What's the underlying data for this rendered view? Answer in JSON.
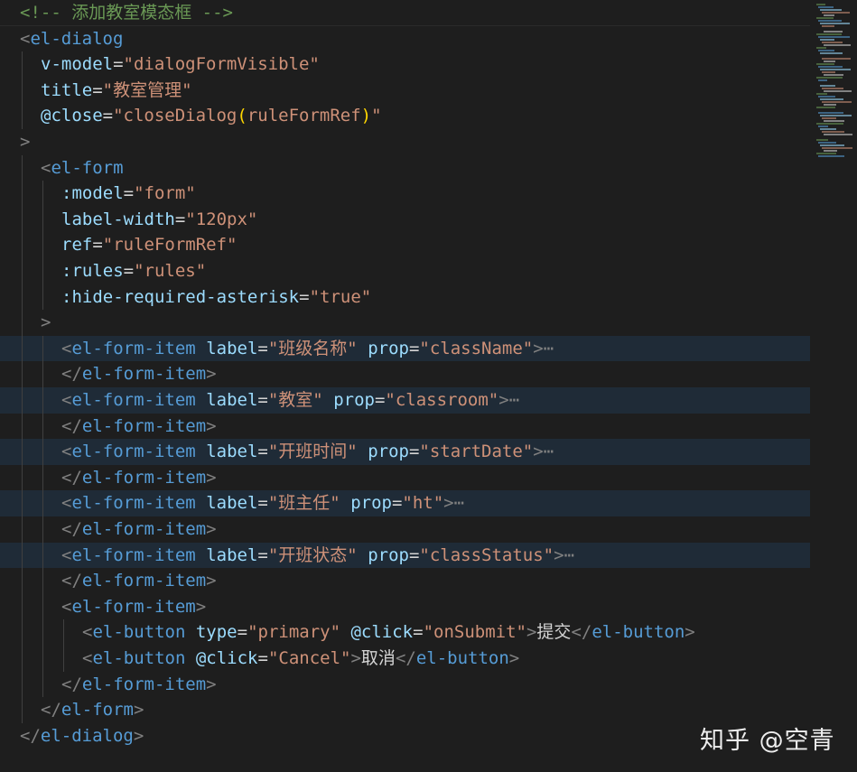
{
  "editor": {
    "tab_size_spaces": 2,
    "colors": {
      "background": "#1e1e1e",
      "highlight": "#1f2b37",
      "tag": "#569cd6",
      "punctuation": "#808080",
      "attribute": "#9cdcfe",
      "string": "#ce9178",
      "text": "#d4d4d4",
      "comment": "#6a9955",
      "paren": "#ffd700"
    },
    "lines": [
      {
        "indent": 0,
        "tokens": [
          [
            "comment",
            "<!-- 添加教室模态框 -->"
          ]
        ]
      },
      {
        "indent": 0,
        "tokens": [
          [
            "punc",
            "<"
          ],
          [
            "tag",
            "el-dialog"
          ]
        ]
      },
      {
        "indent": 1,
        "tokens": [
          [
            "attr",
            "v-model"
          ],
          [
            "text",
            "="
          ],
          [
            "str",
            "\"dialogFormVisible\""
          ]
        ]
      },
      {
        "indent": 1,
        "tokens": [
          [
            "attr",
            "title"
          ],
          [
            "text",
            "="
          ],
          [
            "str",
            "\"教室管理\""
          ]
        ]
      },
      {
        "indent": 1,
        "tokens": [
          [
            "attr",
            "@close"
          ],
          [
            "text",
            "="
          ],
          [
            "str",
            "\"closeDialog"
          ],
          [
            "paren",
            "("
          ],
          [
            "str",
            "ruleFormRef"
          ],
          [
            "paren",
            ")"
          ],
          [
            "str",
            "\""
          ]
        ]
      },
      {
        "indent": 0,
        "tokens": [
          [
            "punc",
            ">"
          ]
        ]
      },
      {
        "indent": 1,
        "tokens": [
          [
            "punc",
            "<"
          ],
          [
            "tag",
            "el-form"
          ]
        ]
      },
      {
        "indent": 2,
        "tokens": [
          [
            "attr",
            ":model"
          ],
          [
            "text",
            "="
          ],
          [
            "str",
            "\"form\""
          ]
        ]
      },
      {
        "indent": 2,
        "tokens": [
          [
            "attr",
            "label-width"
          ],
          [
            "text",
            "="
          ],
          [
            "str",
            "\"120px\""
          ]
        ]
      },
      {
        "indent": 2,
        "tokens": [
          [
            "attr",
            "ref"
          ],
          [
            "text",
            "="
          ],
          [
            "str",
            "\"ruleFormRef\""
          ]
        ]
      },
      {
        "indent": 2,
        "tokens": [
          [
            "attr",
            ":rules"
          ],
          [
            "text",
            "="
          ],
          [
            "str",
            "\"rules\""
          ]
        ]
      },
      {
        "indent": 2,
        "tokens": [
          [
            "attr",
            ":hide-required-asterisk"
          ],
          [
            "text",
            "="
          ],
          [
            "str",
            "\"true\""
          ]
        ]
      },
      {
        "indent": 1,
        "tokens": [
          [
            "punc",
            ">"
          ]
        ]
      },
      {
        "indent": 2,
        "highlight": true,
        "tokens": [
          [
            "punc",
            "<"
          ],
          [
            "tag",
            "el-form-item"
          ],
          [
            "text",
            " "
          ],
          [
            "attr",
            "label"
          ],
          [
            "text",
            "="
          ],
          [
            "str",
            "\"班级名称\""
          ],
          [
            "text",
            " "
          ],
          [
            "attr",
            "prop"
          ],
          [
            "text",
            "="
          ],
          [
            "str",
            "\"className\""
          ],
          [
            "punc",
            ">"
          ],
          [
            "fold",
            "⋯"
          ]
        ]
      },
      {
        "indent": 2,
        "tokens": [
          [
            "punc",
            "</"
          ],
          [
            "tag",
            "el-form-item"
          ],
          [
            "punc",
            ">"
          ]
        ]
      },
      {
        "indent": 2,
        "highlight": true,
        "tokens": [
          [
            "punc",
            "<"
          ],
          [
            "tag",
            "el-form-item"
          ],
          [
            "text",
            " "
          ],
          [
            "attr",
            "label"
          ],
          [
            "text",
            "="
          ],
          [
            "str",
            "\"教室\""
          ],
          [
            "text",
            " "
          ],
          [
            "attr",
            "prop"
          ],
          [
            "text",
            "="
          ],
          [
            "str",
            "\"classroom\""
          ],
          [
            "punc",
            ">"
          ],
          [
            "fold",
            "⋯"
          ]
        ]
      },
      {
        "indent": 2,
        "tokens": [
          [
            "punc",
            "</"
          ],
          [
            "tag",
            "el-form-item"
          ],
          [
            "punc",
            ">"
          ]
        ]
      },
      {
        "indent": 2,
        "highlight": true,
        "tokens": [
          [
            "punc",
            "<"
          ],
          [
            "tag",
            "el-form-item"
          ],
          [
            "text",
            " "
          ],
          [
            "attr",
            "label"
          ],
          [
            "text",
            "="
          ],
          [
            "str",
            "\"开班时间\""
          ],
          [
            "text",
            " "
          ],
          [
            "attr",
            "prop"
          ],
          [
            "text",
            "="
          ],
          [
            "str",
            "\"startDate\""
          ],
          [
            "punc",
            ">"
          ],
          [
            "fold",
            "⋯"
          ]
        ]
      },
      {
        "indent": 2,
        "tokens": [
          [
            "punc",
            "</"
          ],
          [
            "tag",
            "el-form-item"
          ],
          [
            "punc",
            ">"
          ]
        ]
      },
      {
        "indent": 2,
        "highlight": true,
        "tokens": [
          [
            "punc",
            "<"
          ],
          [
            "tag",
            "el-form-item"
          ],
          [
            "text",
            " "
          ],
          [
            "attr",
            "label"
          ],
          [
            "text",
            "="
          ],
          [
            "str",
            "\"班主任\""
          ],
          [
            "text",
            " "
          ],
          [
            "attr",
            "prop"
          ],
          [
            "text",
            "="
          ],
          [
            "str",
            "\"ht\""
          ],
          [
            "punc",
            ">"
          ],
          [
            "fold",
            "⋯"
          ]
        ]
      },
      {
        "indent": 2,
        "tokens": [
          [
            "punc",
            "</"
          ],
          [
            "tag",
            "el-form-item"
          ],
          [
            "punc",
            ">"
          ]
        ]
      },
      {
        "indent": 2,
        "highlight": true,
        "tokens": [
          [
            "punc",
            "<"
          ],
          [
            "tag",
            "el-form-item"
          ],
          [
            "text",
            " "
          ],
          [
            "attr",
            "label"
          ],
          [
            "text",
            "="
          ],
          [
            "str",
            "\"开班状态\""
          ],
          [
            "text",
            " "
          ],
          [
            "attr",
            "prop"
          ],
          [
            "text",
            "="
          ],
          [
            "str",
            "\"classStatus\""
          ],
          [
            "punc",
            ">"
          ],
          [
            "fold",
            "⋯"
          ]
        ]
      },
      {
        "indent": 2,
        "tokens": [
          [
            "punc",
            "</"
          ],
          [
            "tag",
            "el-form-item"
          ],
          [
            "punc",
            ">"
          ]
        ]
      },
      {
        "indent": 2,
        "tokens": [
          [
            "punc",
            "<"
          ],
          [
            "tag",
            "el-form-item"
          ],
          [
            "punc",
            ">"
          ]
        ]
      },
      {
        "indent": 3,
        "tokens": [
          [
            "punc",
            "<"
          ],
          [
            "tag",
            "el-button"
          ],
          [
            "text",
            " "
          ],
          [
            "attr",
            "type"
          ],
          [
            "text",
            "="
          ],
          [
            "str",
            "\"primary\""
          ],
          [
            "text",
            " "
          ],
          [
            "attr",
            "@click"
          ],
          [
            "text",
            "="
          ],
          [
            "str",
            "\"onSubmit\""
          ],
          [
            "punc",
            ">"
          ],
          [
            "text",
            "提交"
          ],
          [
            "punc",
            "</"
          ],
          [
            "tag",
            "el-button"
          ],
          [
            "punc",
            ">"
          ]
        ]
      },
      {
        "indent": 3,
        "tokens": [
          [
            "punc",
            "<"
          ],
          [
            "tag",
            "el-button"
          ],
          [
            "text",
            " "
          ],
          [
            "attr",
            "@click"
          ],
          [
            "text",
            "="
          ],
          [
            "str",
            "\"Cancel\""
          ],
          [
            "punc",
            ">"
          ],
          [
            "text",
            "取消"
          ],
          [
            "punc",
            "</"
          ],
          [
            "tag",
            "el-button"
          ],
          [
            "punc",
            ">"
          ]
        ]
      },
      {
        "indent": 2,
        "tokens": [
          [
            "punc",
            "</"
          ],
          [
            "tag",
            "el-form-item"
          ],
          [
            "punc",
            ">"
          ]
        ]
      },
      {
        "indent": 1,
        "tokens": [
          [
            "punc",
            "</"
          ],
          [
            "tag",
            "el-form"
          ],
          [
            "punc",
            ">"
          ]
        ]
      },
      {
        "indent": 0,
        "tokens": [
          [
            "punc",
            "</"
          ],
          [
            "tag",
            "el-dialog"
          ],
          [
            "punc",
            ">"
          ]
        ]
      }
    ]
  },
  "watermark": {
    "text": "知乎 @空青"
  }
}
